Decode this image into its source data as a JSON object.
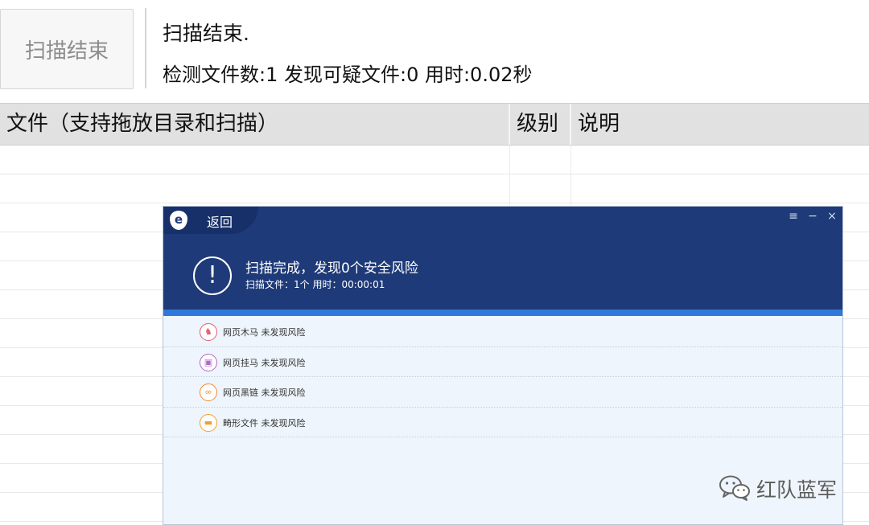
{
  "toolbar": {
    "scan_button": "扫描结束",
    "status_title": "扫描结束.",
    "status_detail": "检测文件数:1 发现可疑文件:0 用时:0.02秒"
  },
  "table": {
    "columns": [
      "文件（支持拖放目录和扫描）",
      "级别",
      "说明"
    ],
    "rows": []
  },
  "dialog": {
    "back_label": "返回",
    "logo_icon": "e-logo-icon",
    "window_controls": [
      "≡",
      "−",
      "×"
    ],
    "result_icon": "exclamation-circle-icon",
    "result_title": "扫描完成，发现0个安全风险",
    "result_sub": "扫描文件：1个    用时：00:00:01",
    "progress": 1.0,
    "items": [
      {
        "icon": "horse-icon",
        "label": "网页木马 未发现风险",
        "color": "#e06070"
      },
      {
        "icon": "webpage-hook-icon",
        "label": "网页挂马 未发现风险",
        "color": "#b06ac8"
      },
      {
        "icon": "link-icon",
        "label": "网页黑链 未发现风险",
        "color": "#f08a3a"
      },
      {
        "icon": "folder-icon",
        "label": "畸形文件 未发现风险",
        "color": "#f0a030"
      }
    ]
  },
  "watermark": {
    "text": "红队蓝军",
    "icon": "wechat-icon"
  },
  "colors": {
    "dialog_header": "#1e3a78",
    "progress": "#2e79d9",
    "dialog_body": "#eef5fc"
  }
}
